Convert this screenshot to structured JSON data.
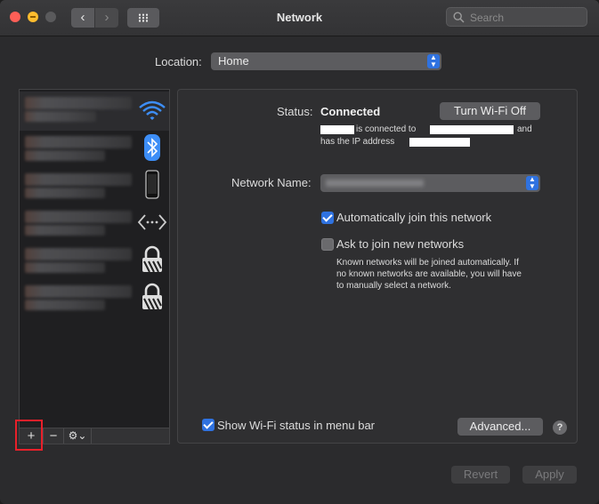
{
  "window": {
    "title": "Network"
  },
  "search": {
    "placeholder": "Search"
  },
  "location": {
    "label": "Location:",
    "value": "Home"
  },
  "sidebar": {
    "services": [
      {
        "icon": "wifi-icon"
      },
      {
        "icon": "bluetooth-icon"
      },
      {
        "icon": "iphone-icon"
      },
      {
        "icon": "ethernet-arrows-icon"
      },
      {
        "icon": "vpn-lock-icon"
      },
      {
        "icon": "vpn-lock-icon"
      }
    ],
    "toolbar": {
      "add": "+",
      "remove": "−",
      "gear": "⚙⌄"
    }
  },
  "detail": {
    "status_label": "Status:",
    "status_value": "Connected",
    "turn_off_button": "Turn Wi-Fi Off",
    "status_desc_1a": "is connected to",
    "status_desc_1b": "and",
    "status_desc_2": "has the IP address",
    "network_name_label": "Network Name:",
    "auto_join_label": "Automatically join this network",
    "auto_join_checked": true,
    "ask_join_label": "Ask to join new networks",
    "ask_join_checked": false,
    "ask_join_desc_1": "Known networks will be joined automatically. If",
    "ask_join_desc_2": "no known networks are available, you will have",
    "ask_join_desc_3": "to manually select a network.",
    "show_status_label": "Show Wi-Fi status in menu bar",
    "show_status_checked": true,
    "advanced_button": "Advanced...",
    "help_button": "?"
  },
  "footer": {
    "revert_button": "Revert",
    "apply_button": "Apply"
  },
  "colors": {
    "accent": "#2f72e0",
    "window_bg": "#2b2b2d",
    "highlight": "#e8202a"
  }
}
